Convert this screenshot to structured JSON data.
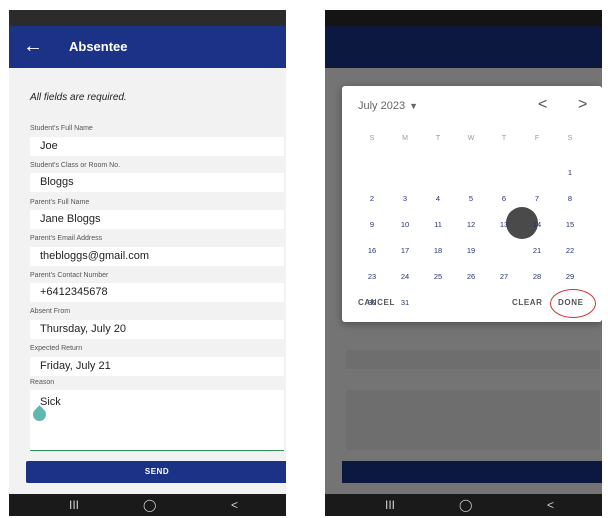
{
  "left": {
    "title": "Absentee",
    "required_note": "All fields are required.",
    "fields": [
      {
        "label": "Student's Full Name",
        "value": "Joe"
      },
      {
        "label": "Student's Class or Room No.",
        "value": "Bloggs"
      },
      {
        "label": "Parent's Full Name",
        "value": "Jane Bloggs"
      },
      {
        "label": "Parent's Email Address",
        "value": "thebloggs@gmail.com"
      },
      {
        "label": "Parent's Contact Number",
        "value": "+6412345678"
      },
      {
        "label": "Absent From",
        "value": "Thursday, July 20"
      },
      {
        "label": "Expected Return",
        "value": "Friday, July 21"
      }
    ],
    "reason": {
      "label": "Reason",
      "value": "Sick"
    },
    "send_label": "SEND",
    "nav": {
      "recent": "III",
      "home": "◯",
      "back": "<"
    }
  },
  "right": {
    "month_label": "July 2023",
    "weekdays": [
      "S",
      "M",
      "T",
      "W",
      "T",
      "F",
      "S"
    ],
    "days_row1": [
      "",
      "",
      "",
      "",
      "",
      "",
      "1"
    ],
    "days_row2": [
      "2",
      "3",
      "4",
      "5",
      "6",
      "7",
      "8"
    ],
    "days_row3": [
      "9",
      "10",
      "11",
      "12",
      "13",
      "14",
      "15"
    ],
    "days_row4": [
      "16",
      "17",
      "18",
      "19",
      "20",
      "21",
      "22"
    ],
    "days_row5": [
      "23",
      "24",
      "25",
      "26",
      "27",
      "28",
      "29"
    ],
    "days_row6": [
      "30",
      "31"
    ],
    "selected_day": "20",
    "cancel_label": "CANCEL",
    "clear_label": "CLEAR",
    "done_label": "DONE",
    "nav": {
      "recent": "III",
      "home": "◯",
      "back": "<"
    }
  },
  "colors": {
    "brand": "#1b3287",
    "highlight": "#d63030",
    "selected": "#4a4a4a"
  }
}
